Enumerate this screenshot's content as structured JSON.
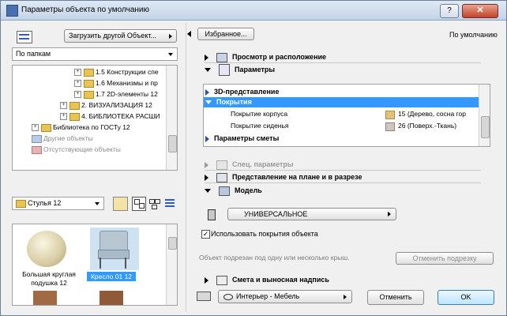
{
  "window": {
    "title": "Параметры объекта по умолчанию",
    "help_label": "?",
    "close_label": "✕"
  },
  "left": {
    "load_button": "Загрузить другой Объект...",
    "folder_mode": "По папкам",
    "tree": [
      {
        "label": "1.5 Конструкции спе"
      },
      {
        "label": "1.6 Механизмы и пр"
      },
      {
        "label": "1.7 2D-элементы 12"
      },
      {
        "label": "2. ВИЗУАЛИЗАЦИЯ 12"
      },
      {
        "label": "4. БИБЛИОТЕКА РАСШИ"
      },
      {
        "label": "Библиотека по ГОСТу 12"
      },
      {
        "label": "Другие объекты"
      },
      {
        "label": "Отсутствующие объекты"
      }
    ],
    "library_select": "Стулья 12",
    "thumbs": [
      {
        "label": "Большая круглая подушка 12"
      },
      {
        "label": "Кресло 01 12"
      }
    ]
  },
  "right": {
    "favorites_button": "Избранное...",
    "default_label": "По умолчанию",
    "sections": {
      "view_placement": "Просмотр и расположение",
      "parameters": "Параметры",
      "spec_params": "Спец. параметры",
      "plan_section": "Представление на плане и в разрезе",
      "model": "Модель",
      "estimate": "Смета и выносная надпись"
    },
    "param_rows": {
      "view3d": "3D-представление",
      "coverings": "Покрытия",
      "body_cover": "Покрытие корпуса",
      "body_cover_value": "15 (Дерево, сосна гор",
      "seat_cover": "Покрытие сиденья",
      "seat_cover_value": "26 (Поверх.-Ткань)",
      "estimate_params": "Параметры сметы"
    },
    "model_select": "УНИВЕРСАЛЬНОЕ",
    "use_cover_label": "Использовать покрытия объекта",
    "roof_note": "Объект подрезан под одну или несколько крыш.",
    "cancel_trim": "Отменить подрезку",
    "layer_select": "Интерьер - Мебель",
    "cancel": "Отменить",
    "ok": "OK"
  },
  "colors": {
    "selection": "#3399ff",
    "wood_swatch": "#e5c07b",
    "fabric_swatch": "#cfc6bd"
  }
}
